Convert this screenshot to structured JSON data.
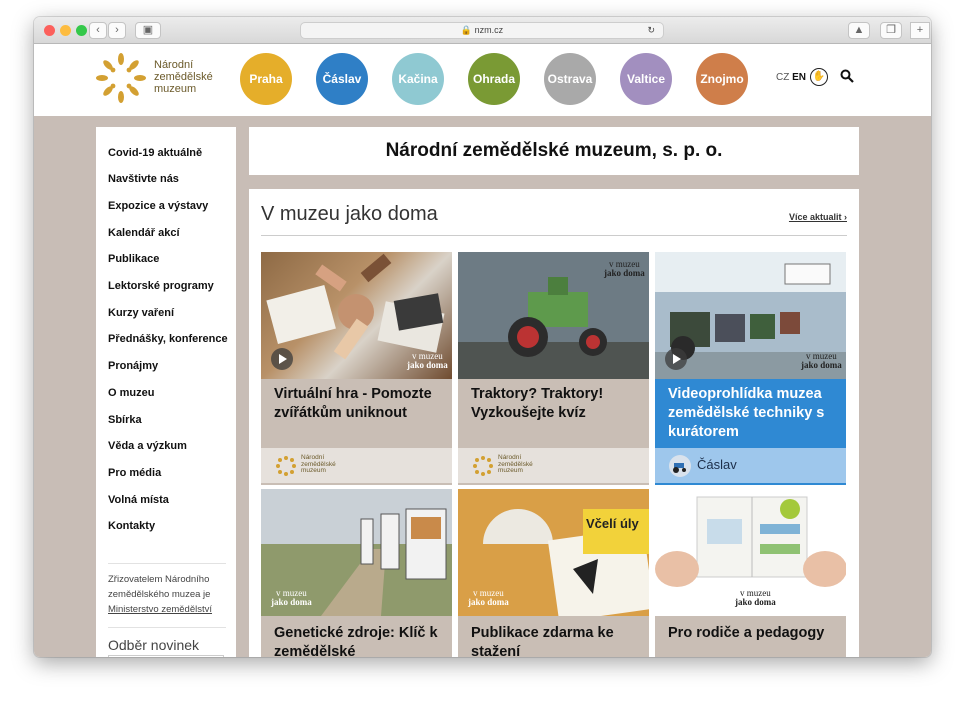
{
  "browser": {
    "url": "nzm.cz"
  },
  "header": {
    "logo_lines": [
      "Národní",
      "zemědělské",
      "muzeum"
    ],
    "branches": [
      {
        "label": "Praha",
        "color": "#e5ae2a"
      },
      {
        "label": "Čáslav",
        "color": "#2f7fc6"
      },
      {
        "label": "Kačina",
        "color": "#8fc9d2"
      },
      {
        "label": "Ohrada",
        "color": "#7a9a34"
      },
      {
        "label": "Ostrava",
        "color": "#a9a9a9"
      },
      {
        "label": "Valtice",
        "color": "#a28fbf"
      },
      {
        "label": "Znojmo",
        "color": "#cf7e4a"
      }
    ],
    "lang_cz": "CZ",
    "lang_en": "EN"
  },
  "sidebar": {
    "items": [
      "Covid-19 aktuálně",
      "Navštivte nás",
      "Expozice a výstavy",
      "Kalendář akcí",
      "Publikace",
      "Lektorské programy",
      "Kurzy vaření",
      "Přednášky, konference",
      "Pronájmy",
      "O muzeu",
      "Sbírka",
      "Věda a výzkum",
      "Pro média",
      "Volná místa",
      "Kontakty"
    ],
    "info_text": "Zřizovatelem Národního zemědělského muzea je",
    "info_link": "Ministerstvo zemědělství",
    "newsletter_title": "Odběr novinek"
  },
  "main": {
    "page_title": "Národní zemědělské muzeum, s. p. o.",
    "section_title": "V muzeu jako doma",
    "more_link": "Více aktualit",
    "badge_line1": "v muzeu",
    "badge_line2": "jako doma",
    "cards": [
      {
        "title": "Virtuální hra - Pomozte zvířátkům uniknout",
        "footer": "Národní zemědělské muzeum"
      },
      {
        "title": "Traktory? Traktory! Vyzkoušejte kvíz",
        "footer": "Národní zemědělské muzeum"
      },
      {
        "title": "Videoprohlídka muzea zemědělské techniky s kurátorem",
        "footer": "Čáslav"
      },
      {
        "title": "Genetické zdroje: Klíč k zemědělské",
        "footer": ""
      },
      {
        "title": "Publikace zdarma ke stažení",
        "footer": "",
        "image_text": "Včelí úly"
      },
      {
        "title": "Pro rodiče a pedagogy",
        "footer": ""
      }
    ]
  }
}
